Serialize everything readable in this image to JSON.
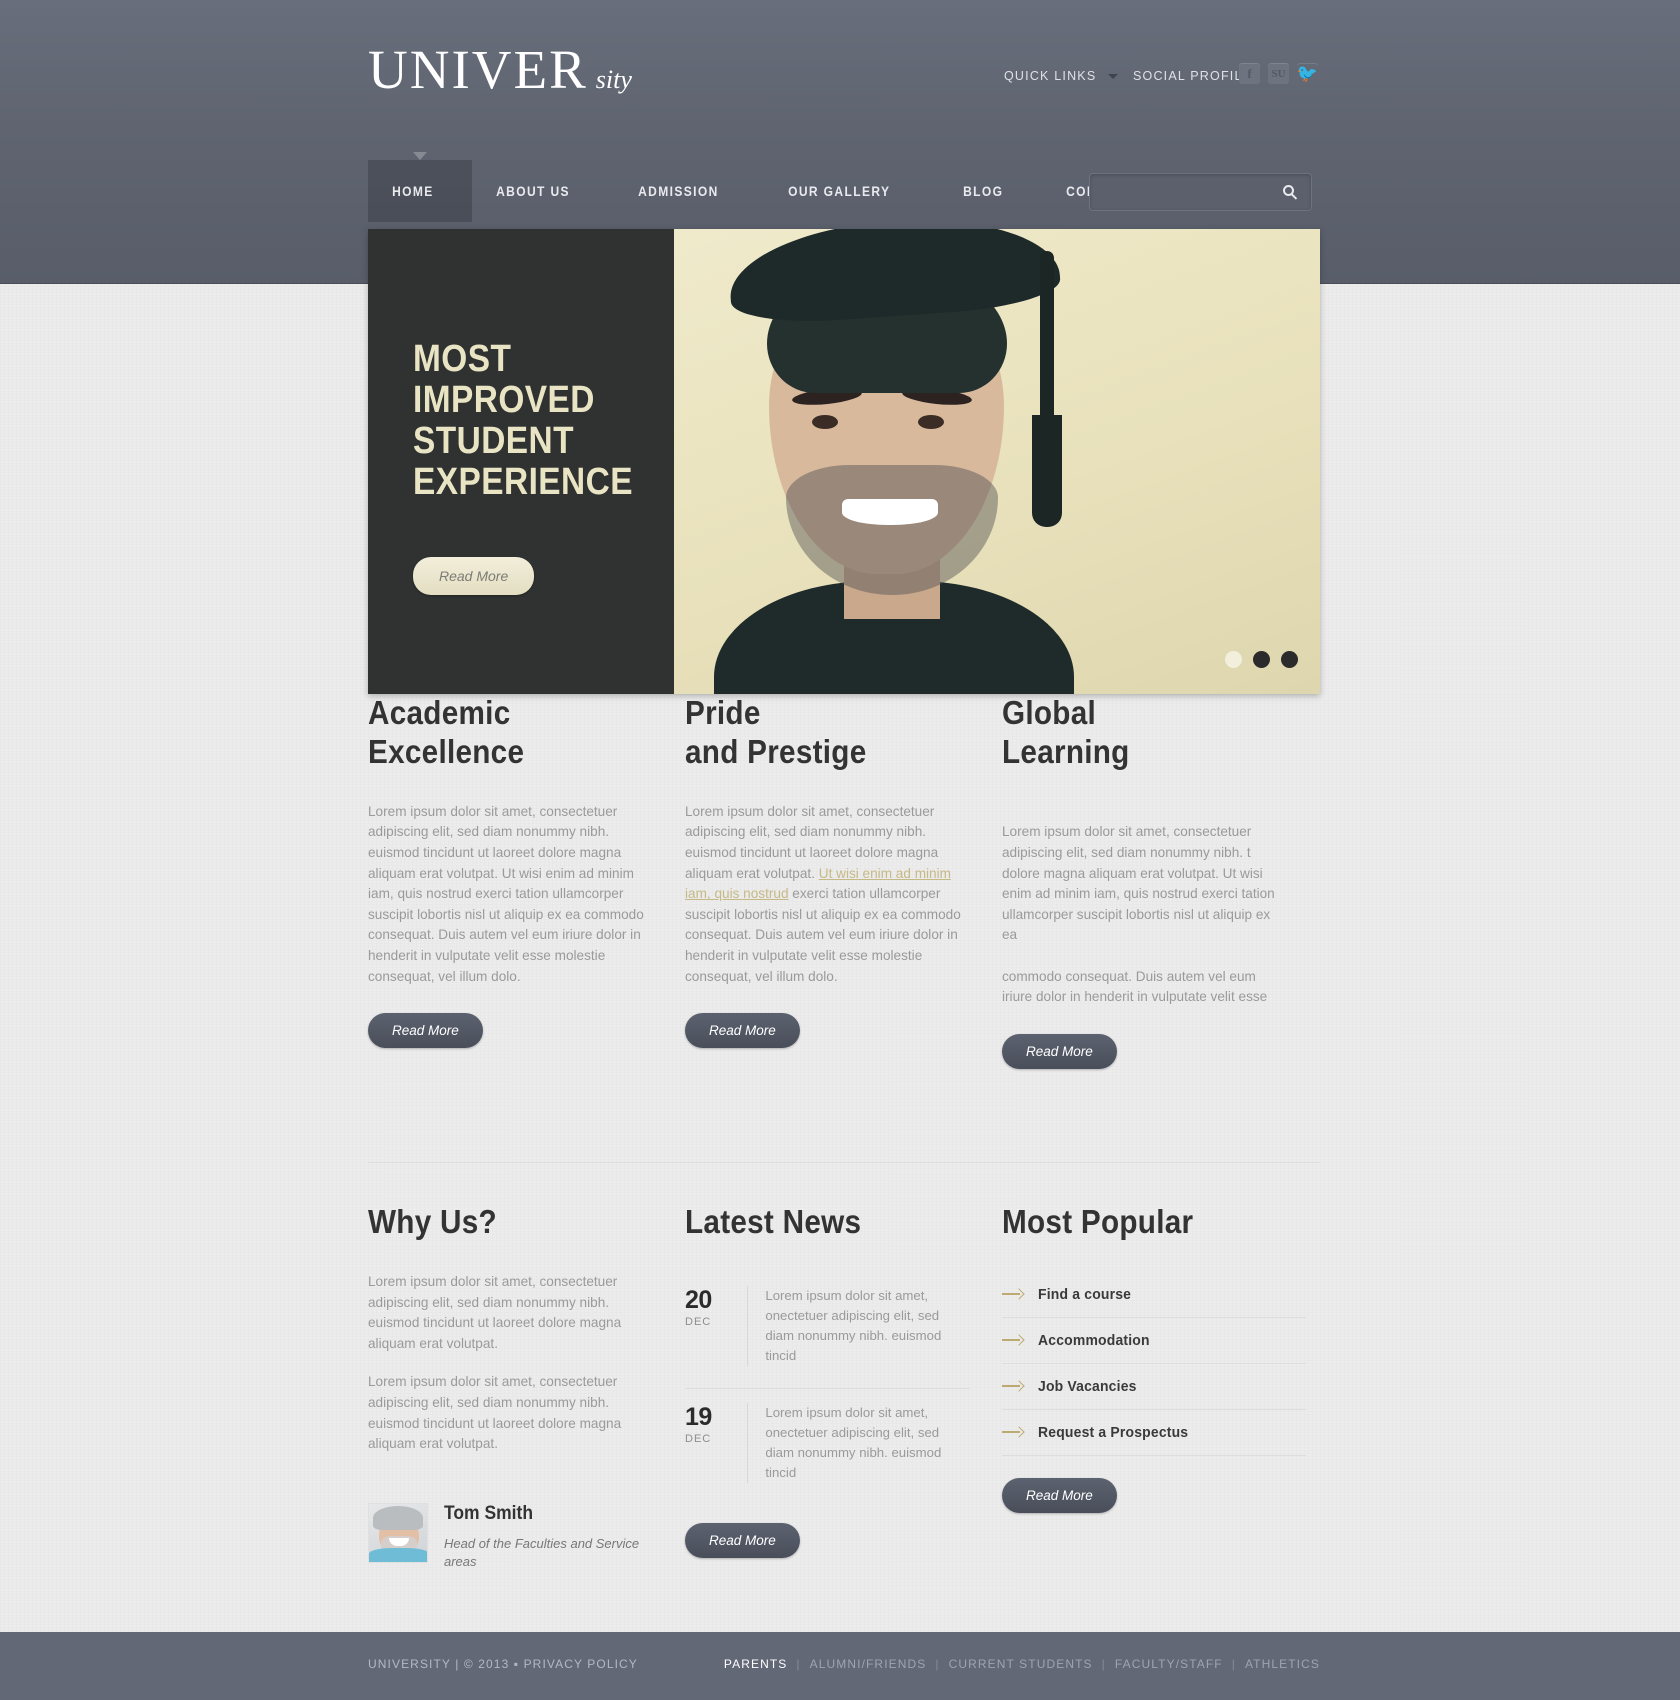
{
  "site": {
    "logo_main": "UNIVER",
    "logo_sub": "sity"
  },
  "header": {
    "quick_links_label": "QUICK LINKS",
    "social_label": "SOCIAL PROFILES",
    "social_icons": [
      {
        "name": "facebook-icon",
        "glyph": "f"
      },
      {
        "name": "stumbleupon-icon",
        "glyph": "SU"
      },
      {
        "name": "twitter-icon",
        "glyph": "🐦"
      }
    ],
    "nav": [
      {
        "label": "HOME",
        "active": true
      },
      {
        "label": "ABOUT US",
        "active": false
      },
      {
        "label": "ADMISSION",
        "active": false
      },
      {
        "label": "OUR GALLERY",
        "active": false
      },
      {
        "label": "BLOG",
        "active": false
      },
      {
        "label": "CONTACTS",
        "active": false
      }
    ],
    "search": {
      "value": "",
      "placeholder": "",
      "icon": "search-icon"
    }
  },
  "banner": {
    "title": "MOST\nIMPROVED\nSTUDENT\nEXPERIENCE",
    "button_label": "Read More",
    "slides_total": 3,
    "active_slide": 1
  },
  "features": [
    {
      "title": "Academic\nExcellence",
      "text_before": "Lorem ipsum dolor sit amet, consectetuer adipiscing elit, sed diam nonummy nibh. euismod tincidunt ut laoreet dolore magna aliquam erat volutpat. Ut wisi enim ad minim iam, quis nostrud exerci tation ullamcorper suscipit lobortis nisl ut aliquip ex ea commodo consequat. Duis autem vel eum iriure dolor in henderit in vulputate velit esse molestie consequat, vel illum dolo.",
      "link_text": "",
      "text_after": "",
      "button_label": "Read More"
    },
    {
      "title": "Pride\nand Prestige",
      "text_before": "Lorem ipsum dolor sit amet, consectetuer adipiscing elit, sed diam nonummy nibh. euismod tincidunt ut laoreet dolore magna aliquam erat volutpat. ",
      "link_text": "Ut wisi enim ad minim iam, quis nostrud",
      "text_after": " exerci tation ullamcorper suscipit lobortis nisl ut aliquip ex ea commodo consequat. Duis autem vel eum iriure dolor in henderit in vulputate velit esse molestie consequat, vel illum dolo.",
      "button_label": "Read More"
    },
    {
      "title": "Global\nLearning",
      "text_before": "Lorem ipsum dolor sit amet, consectetuer adipiscing elit, sed diam nonummy nibh. t dolore magna aliquam erat volutpat. Ut wisi enim ad minim iam, quis nostrud exerci tation ullamcorper suscipit lobortis nisl ut aliquip ex ea\n\ncommodo consequat. Duis autem vel eum iriure dolor in henderit in vulputate velit esse",
      "link_text": "",
      "text_after": "",
      "button_label": "Read More"
    }
  ],
  "why_us": {
    "title": "Why Us?",
    "paragraph1": "Lorem ipsum dolor sit amet, consectetuer adipiscing elit, sed diam nonummy nibh. euismod tincidunt ut laoreet dolore magna aliquam erat volutpat.",
    "paragraph2": "Lorem ipsum dolor sit amet, consectetuer adipiscing elit, sed diam nonummy nibh. euismod tincidunt ut laoreet dolore magna aliquam erat volutpat.",
    "person": {
      "name": "Tom Smith",
      "role": "Head of the Faculties and Service areas"
    }
  },
  "latest_news": {
    "title": "Latest News",
    "items": [
      {
        "day": "20",
        "month": "DEC",
        "text": "Lorem ipsum dolor sit amet, onectetuer adipiscing elit, sed diam nonummy nibh. euismod tincid"
      },
      {
        "day": "19",
        "month": "DEC",
        "text": "Lorem ipsum dolor sit amet, onectetuer adipiscing elit, sed diam nonummy nibh. euismod tincid"
      }
    ],
    "button_label": "Read More"
  },
  "most_popular": {
    "title": "Most Popular",
    "items": [
      {
        "label": "Find a course"
      },
      {
        "label": "Accommodation"
      },
      {
        "label": "Job Vacancies"
      },
      {
        "label": "Request a Prospectus"
      }
    ],
    "button_label": "Read More"
  },
  "footer": {
    "copyright": "UNIVERSITY  |  © 2013 ▪ PRIVACY POLICY",
    "links": [
      {
        "label": "PARENTS",
        "active": true
      },
      {
        "label": "ALUMNI/FRIENDS",
        "active": false
      },
      {
        "label": "CURRENT STUDENTS",
        "active": false
      },
      {
        "label": "FACULTY/STAFF",
        "active": false
      },
      {
        "label": "ATHLETICS",
        "active": false
      }
    ],
    "separator": "|"
  },
  "colors": {
    "header_bg": "#5f6470",
    "footer_bg": "#636876",
    "accent_gold": "#c5b985",
    "banner_panel": "#2f3231",
    "banner_text": "#e9e4c4",
    "page_bg": "#ececec"
  }
}
